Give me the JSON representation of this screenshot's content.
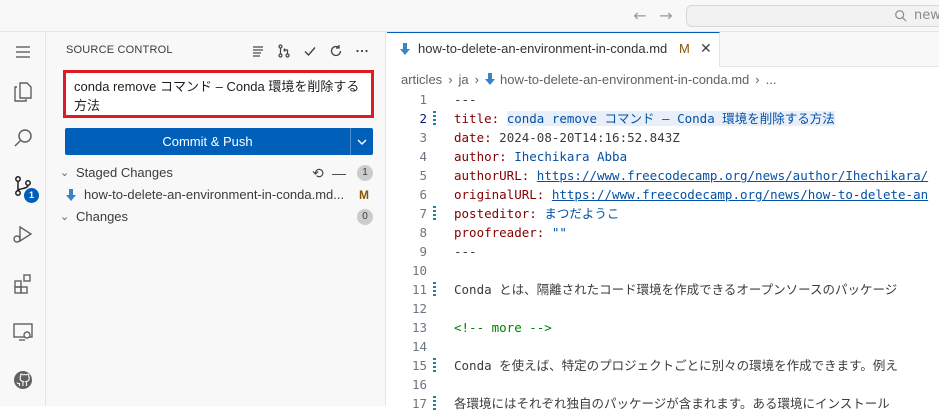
{
  "titlebar": {
    "back_icon": "arrow-left-icon",
    "forward_icon": "arrow-right-icon",
    "search_text": "news"
  },
  "activity_bar": {
    "items": [
      {
        "name": "menu-icon"
      },
      {
        "name": "explorer-icon"
      },
      {
        "name": "search-icon"
      },
      {
        "name": "source-control-icon",
        "badge": "1"
      },
      {
        "name": "run-debug-icon"
      },
      {
        "name": "extensions-icon"
      },
      {
        "name": "remote-explorer-icon"
      },
      {
        "name": "github-icon"
      }
    ]
  },
  "sidebar": {
    "title": "SOURCE CONTROL",
    "commit_message": "conda remove コマンド – Conda 環境を削除する方法",
    "commit_button": "Commit & Push",
    "staged_label": "Staged Changes",
    "staged_count": "1",
    "staged_file": "how-to-delete-an-environment-in-conda.md...",
    "staged_file_status": "M",
    "changes_label": "Changes",
    "changes_count": "0"
  },
  "editor": {
    "tab": {
      "name": "how-to-delete-an-environment-in-conda.md",
      "status": "M"
    },
    "breadcrumb": [
      "articles",
      "ja",
      "how-to-delete-an-environment-in-conda.md",
      "..."
    ],
    "lines": [
      {
        "n": "1",
        "text": "---"
      },
      {
        "n": "2",
        "key": "title:",
        "value": "conda remove コマンド – Conda 環境を削除する方法"
      },
      {
        "n": "3",
        "key": "date:",
        "value": "2024-08-20T14:16:52.843Z"
      },
      {
        "n": "4",
        "key": "author:",
        "value": "Ihechikara Abba"
      },
      {
        "n": "5",
        "key": "authorURL:",
        "value": "https://www.freecodecamp.org/news/author/Ihechikara/"
      },
      {
        "n": "6",
        "key": "originalURL:",
        "value": "https://www.freecodecamp.org/news/how-to-delete-an"
      },
      {
        "n": "7",
        "key": "posteditor:",
        "value": "まつだようこ"
      },
      {
        "n": "8",
        "key": "proofreader:",
        "value": "\"\""
      },
      {
        "n": "9",
        "text": "---"
      },
      {
        "n": "10",
        "text": ""
      },
      {
        "n": "11",
        "text": "Conda とは、隔離されたコード環境を作成できるオープンソースのパッケージ"
      },
      {
        "n": "12",
        "text": ""
      },
      {
        "n": "13",
        "text": "<!-- more -->"
      },
      {
        "n": "14",
        "text": ""
      },
      {
        "n": "15",
        "text": "Conda を使えば、特定のプロジェクトごとに別々の環境を作成できます。例え"
      },
      {
        "n": "16",
        "text": ""
      },
      {
        "n": "17",
        "text": "各環境にはそれぞれ独自のパッケージが含まれます。ある環境にインストール"
      }
    ]
  }
}
